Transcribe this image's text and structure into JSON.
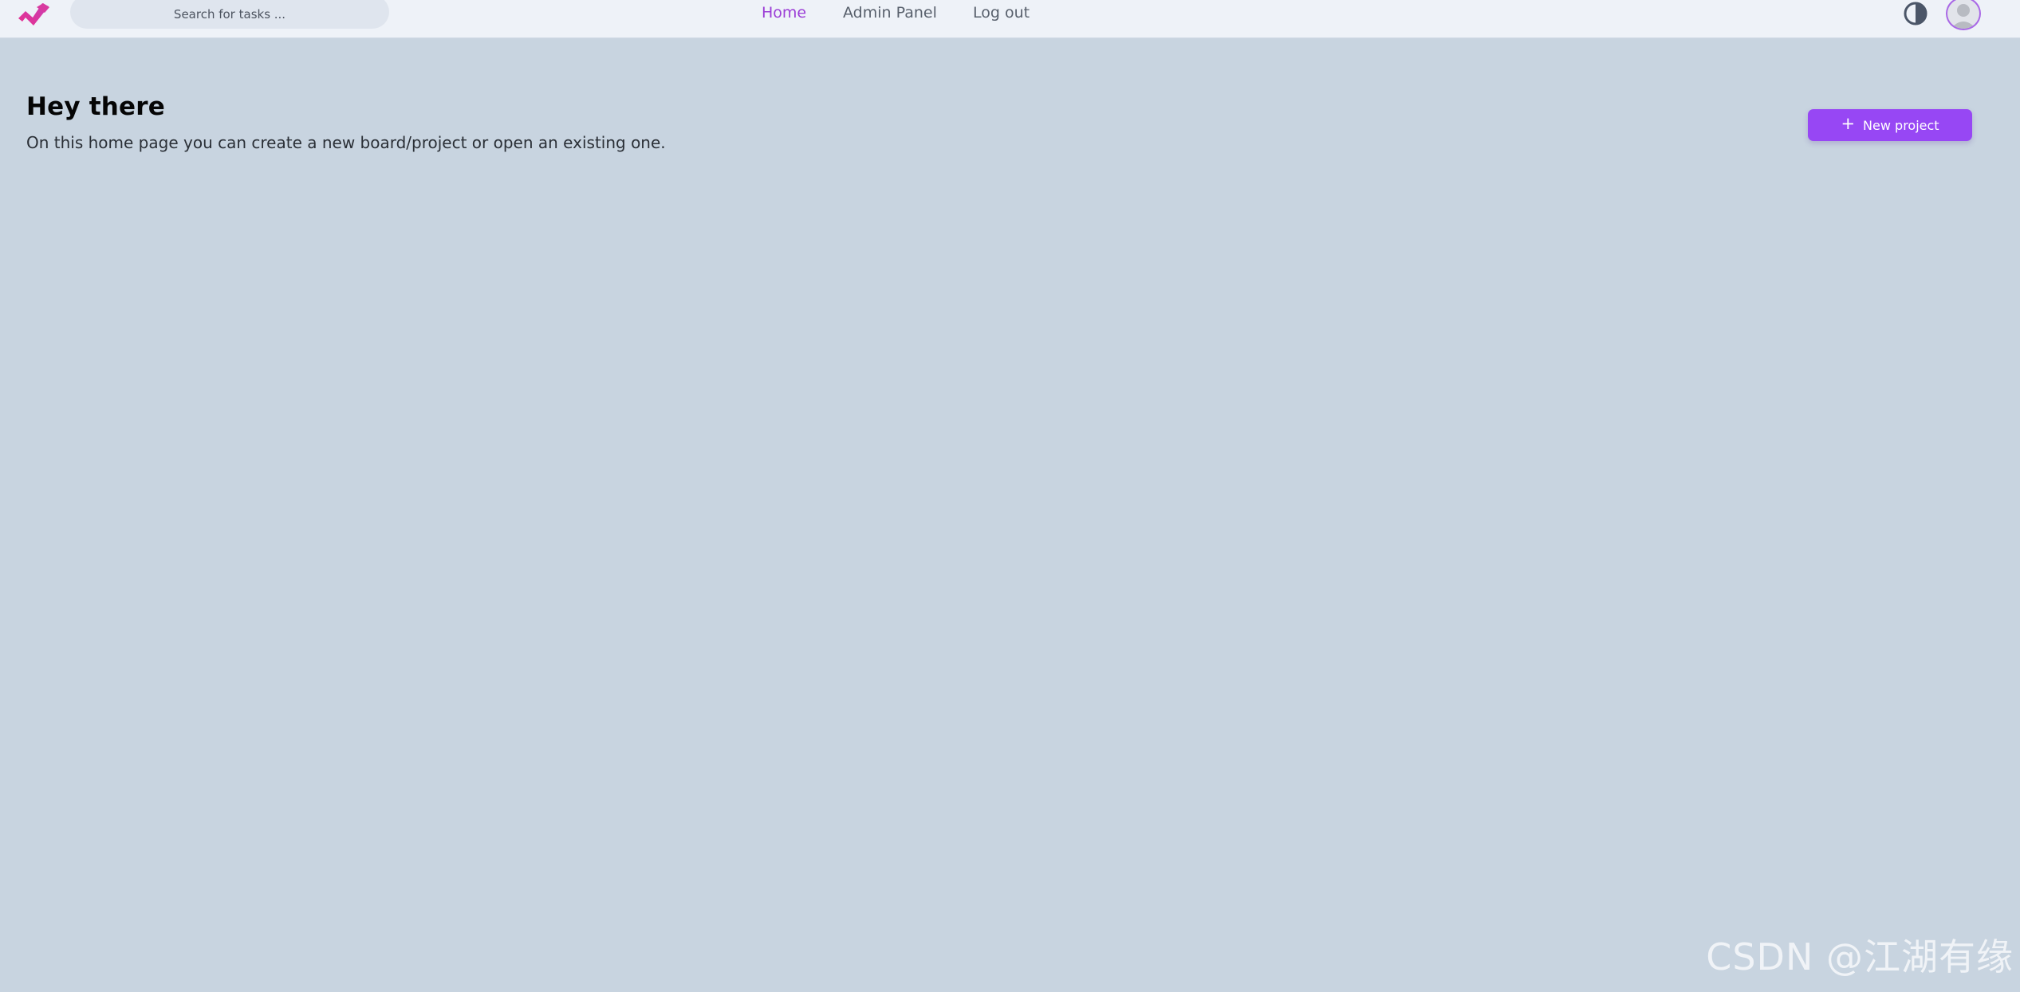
{
  "app": {
    "colors": {
      "accent": "#9747f4",
      "active_nav": "#9b3dd6",
      "topbar_bg": "#eef2f8",
      "page_bg": "#c8d4e0"
    },
    "logo_icon": "app-logo-icon"
  },
  "header": {
    "search": {
      "placeholder": "Search for tasks ..."
    },
    "nav": {
      "home": "Home",
      "admin_panel": "Admin Panel",
      "log_out": "Log out"
    },
    "active_nav": "Home",
    "theme_toggle_icon": "contrast-icon",
    "avatar_icon": "user-avatar-icon"
  },
  "main": {
    "title": "Hey there",
    "subtitle": "On this home page you can create a new board/project or open an existing one.",
    "new_project_label": "New project",
    "new_project_icon": "plus-icon"
  },
  "watermark": {
    "text": "CSDN @江湖有缘"
  }
}
